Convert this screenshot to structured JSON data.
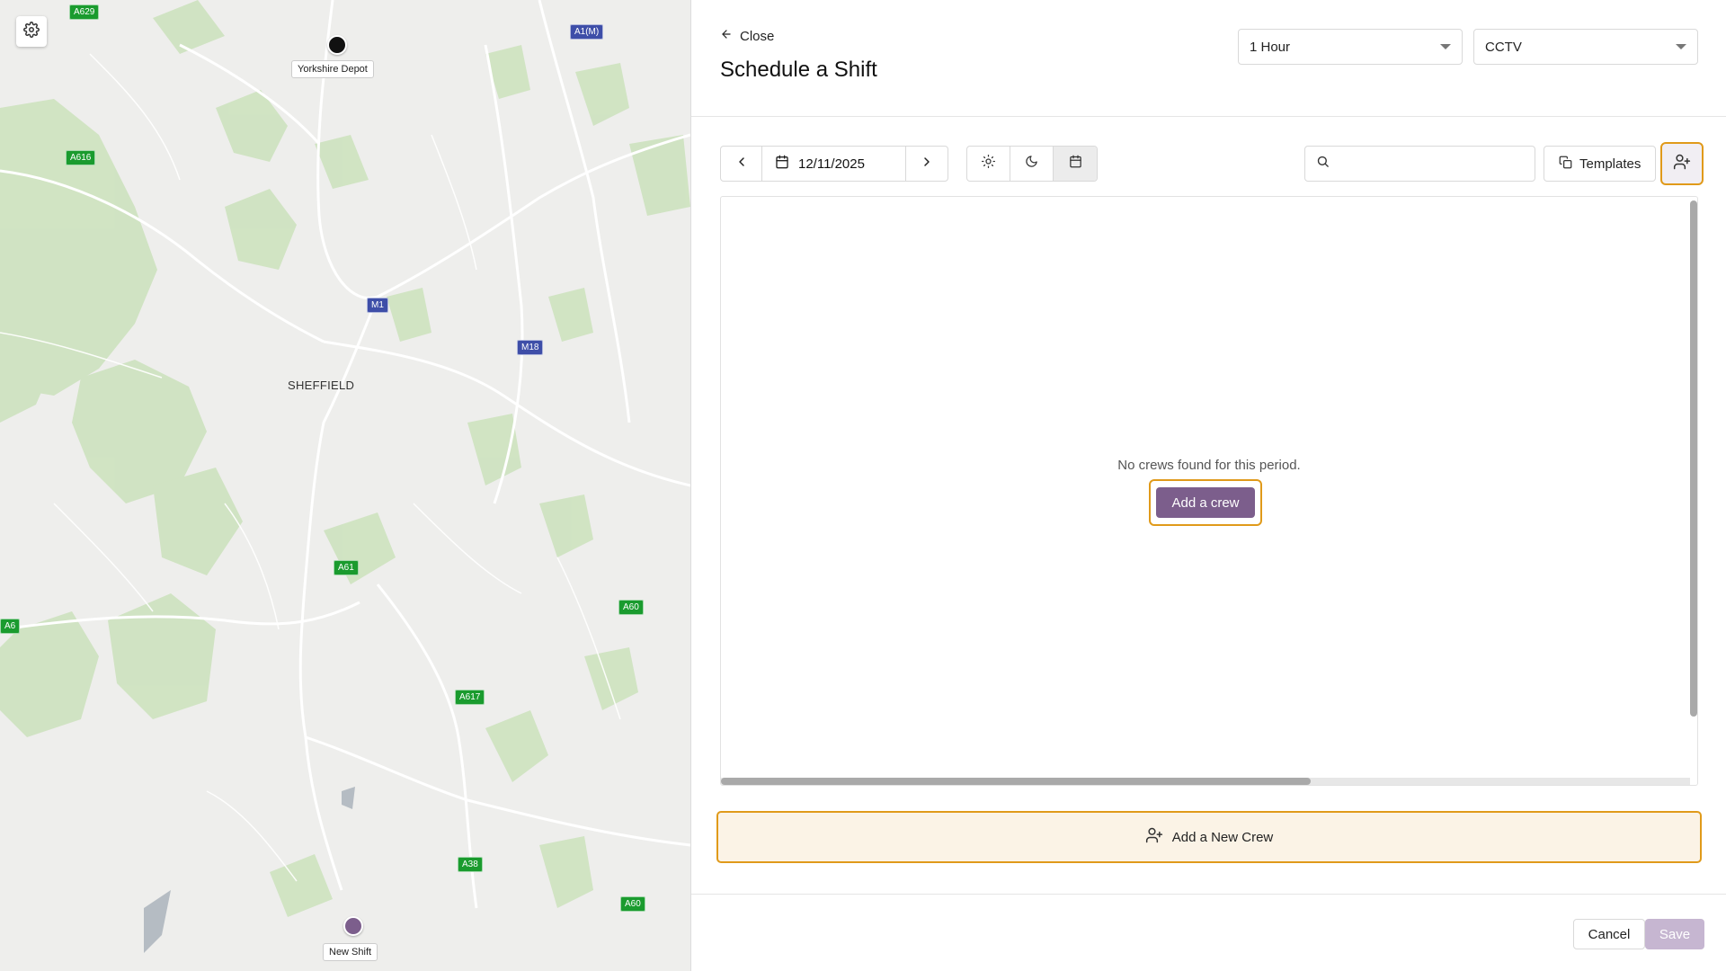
{
  "map": {
    "settings_icon": "gear-icon",
    "city": "SHEFFIELD",
    "roads": [
      {
        "label": "A629",
        "kind": "a"
      },
      {
        "label": "A1(M)",
        "kind": "m"
      },
      {
        "label": "A616",
        "kind": "a"
      },
      {
        "label": "M1",
        "kind": "m"
      },
      {
        "label": "M18",
        "kind": "m"
      },
      {
        "label": "A61",
        "kind": "a"
      },
      {
        "label": "A60",
        "kind": "a"
      },
      {
        "label": "A6",
        "kind": "a"
      },
      {
        "label": "A617",
        "kind": "a"
      },
      {
        "label": "A38",
        "kind": "a"
      },
      {
        "label": "A60",
        "kind": "a"
      }
    ],
    "markers": [
      {
        "label": "Yorkshire Depot",
        "color": "#111111"
      },
      {
        "label": "New Shift",
        "color": "#7c5e8c"
      }
    ]
  },
  "panel": {
    "close_label": "Close",
    "title": "Schedule a Shift",
    "duration_select": "1 Hour",
    "type_select": "CCTV",
    "date": "12/11/2025",
    "search_placeholder": "",
    "templates_label": "Templates",
    "empty_message": "No crews found for this period.",
    "add_crew_label": "Add a crew",
    "add_new_crew_label": "Add a New Crew",
    "cancel_label": "Cancel",
    "save_label": "Save"
  },
  "colors": {
    "accent": "#7c5e8c",
    "highlight": "#e09a1a",
    "save_disabled": "#c6b6d1"
  }
}
